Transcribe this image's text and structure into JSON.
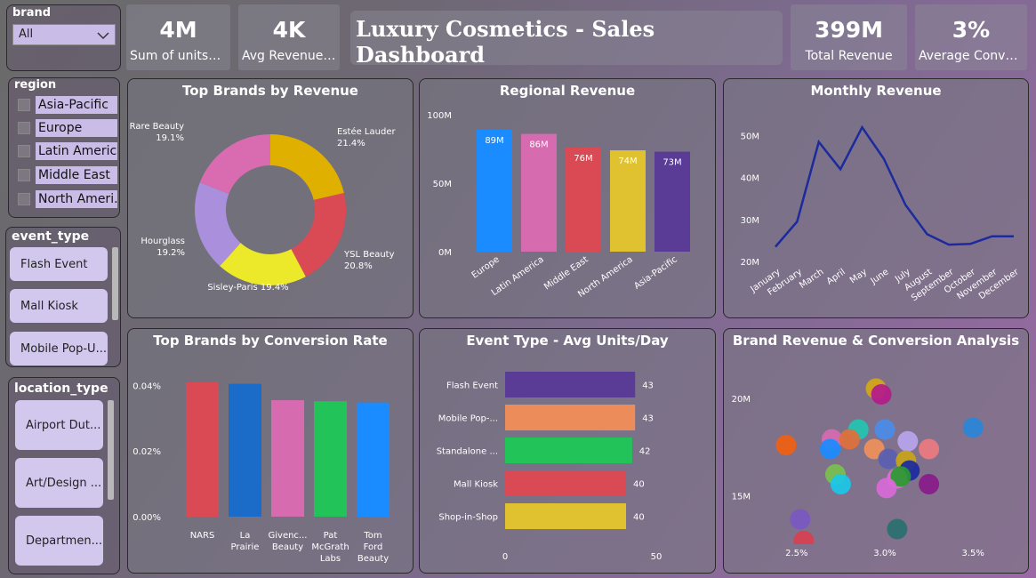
{
  "title": "Luxury Cosmetics - Sales Dashboard",
  "kpis": [
    {
      "value": "4M",
      "label": "Sum of units_sold"
    },
    {
      "value": "4K",
      "label": "Avg Revenue ..."
    },
    {
      "value": "399M",
      "label": "Total Revenue"
    },
    {
      "value": "3%",
      "label": "Average Conver..."
    }
  ],
  "brand_slicer": {
    "title": "brand",
    "selected": "All"
  },
  "region_slicer": {
    "title": "region",
    "items": [
      "Asia-Pacific",
      "Europe",
      "Latin America",
      "Middle East",
      "North Ameri..."
    ]
  },
  "event_slicer": {
    "title": "event_type",
    "items": [
      "Flash Event",
      "Mall Kiosk",
      "Mobile Pop-U..."
    ]
  },
  "location_slicer": {
    "title": "location_type",
    "items": [
      "Airport Dut...",
      "Art/Design ...",
      "Departmen..."
    ]
  },
  "chart_data": [
    {
      "id": "donut",
      "type": "pie",
      "title": "Top Brands by Revenue",
      "labels": [
        "Estée Lauder",
        "YSL Beauty",
        "Sisley-Paris",
        "Hourglass",
        "Rare Beauty"
      ],
      "values": [
        21.4,
        20.8,
        19.4,
        19.2,
        19.1
      ],
      "pct_labels": [
        "21.4%",
        "20.8%",
        "19.4%",
        "19.2%",
        "19.1%"
      ],
      "colors": [
        "#e0b000",
        "#d94a54",
        "#ece82a",
        "#a98fdc",
        "#d96cb0"
      ]
    },
    {
      "id": "regional",
      "type": "bar",
      "title": "Regional Revenue",
      "categories": [
        "Europe",
        "Latin America",
        "Middle East",
        "North America",
        "Asia-Pacific"
      ],
      "values": [
        89,
        86,
        76,
        74,
        73
      ],
      "data_labels": [
        "89M",
        "86M",
        "76M",
        "74M",
        "73M"
      ],
      "colors": [
        "#1a8cff",
        "#d76bb0",
        "#d94a54",
        "#e0c230",
        "#5a3b96"
      ],
      "ylim": [
        0,
        100
      ],
      "yticks": [
        0,
        50,
        100
      ],
      "ytick_labels": [
        "0M",
        "50M",
        "100M"
      ]
    },
    {
      "id": "monthly",
      "type": "line",
      "title": "Monthly Revenue",
      "categories": [
        "January",
        "February",
        "March",
        "April",
        "May",
        "June",
        "July",
        "August",
        "September",
        "October",
        "November",
        "December"
      ],
      "values": [
        23.5,
        29.5,
        48.5,
        42,
        52,
        44.5,
        33.5,
        26.5,
        24,
        24.2,
        26,
        26
      ],
      "ylim": [
        20,
        55
      ],
      "yticks": [
        20,
        30,
        40,
        50
      ],
      "ytick_labels": [
        "20M",
        "30M",
        "40M",
        "50M"
      ],
      "color": "#1c2a9e"
    },
    {
      "id": "conversion",
      "type": "bar",
      "title": "Top Brands by Conversion Rate",
      "categories": [
        "NARS",
        "La Prairie",
        "Givench... Beauty",
        "Pat McGrath Labs",
        "Tom Ford Beauty"
      ],
      "category_lines": [
        [
          "NARS"
        ],
        [
          "La",
          "Prairie"
        ],
        [
          "Givenc...",
          "Beauty"
        ],
        [
          "Pat",
          "McGrath",
          "Labs"
        ],
        [
          "Tom",
          "Ford",
          "Beauty"
        ]
      ],
      "values": [
        0.041,
        0.0405,
        0.0355,
        0.0352,
        0.0348
      ],
      "colors": [
        "#d94a54",
        "#1a6cc8",
        "#d76bb0",
        "#22c45a",
        "#1a8cff"
      ],
      "ylim": [
        0,
        0.045
      ],
      "yticks": [
        0,
        0.02,
        0.04
      ],
      "ytick_labels": [
        "0.00%",
        "0.02%",
        "0.04%"
      ]
    },
    {
      "id": "event",
      "type": "bar",
      "orientation": "horizontal",
      "title": "Event Type - Avg Units/Day",
      "categories": [
        "Flash Event",
        "Mobile Pop-...",
        "Standalone ...",
        "Mall Kiosk",
        "Shop-in-Shop"
      ],
      "values": [
        43,
        43,
        42,
        40,
        40
      ],
      "data_labels": [
        "43",
        "43",
        "42",
        "40",
        "40"
      ],
      "colors": [
        "#5a3b96",
        "#ec8c5a",
        "#22c45a",
        "#d94a54",
        "#e0c230"
      ],
      "xlim": [
        0,
        50
      ],
      "xticks": [
        0,
        50
      ],
      "xtick_labels": [
        "0",
        "50"
      ]
    },
    {
      "id": "scatter",
      "type": "scatter",
      "title": "Brand Revenue & Conversion Analysis",
      "xlim": [
        2.4,
        3.6
      ],
      "ylim": [
        12.8,
        21.5
      ],
      "xticks": [
        2.5,
        3.0,
        3.5
      ],
      "xtick_labels": [
        "2.5%",
        "3.0%",
        "3.5%"
      ],
      "yticks": [
        15,
        20
      ],
      "ytick_labels": [
        "15M",
        "20M"
      ],
      "points": [
        {
          "x": 2.95,
          "y": 20.5,
          "c": "#d4a816"
        },
        {
          "x": 2.98,
          "y": 20.2,
          "c": "#b41a8a"
        },
        {
          "x": 3.5,
          "y": 18.5,
          "c": "#2a86d8"
        },
        {
          "x": 2.85,
          "y": 18.4,
          "c": "#22c4b0"
        },
        {
          "x": 3.0,
          "y": 18.4,
          "c": "#4a8ce8"
        },
        {
          "x": 2.7,
          "y": 17.9,
          "c": "#d76bb0"
        },
        {
          "x": 2.8,
          "y": 17.9,
          "c": "#e0703a"
        },
        {
          "x": 3.13,
          "y": 17.8,
          "c": "#b8a4ec"
        },
        {
          "x": 2.44,
          "y": 17.6,
          "c": "#f06010"
        },
        {
          "x": 2.69,
          "y": 17.4,
          "c": "#1a8cff"
        },
        {
          "x": 2.94,
          "y": 17.4,
          "c": "#f0905a"
        },
        {
          "x": 3.25,
          "y": 17.4,
          "c": "#ee7a80"
        },
        {
          "x": 3.02,
          "y": 16.9,
          "c": "#5a60b0"
        },
        {
          "x": 3.12,
          "y": 16.8,
          "c": "#c8a418"
        },
        {
          "x": 3.14,
          "y": 16.3,
          "c": "#1a2a9e"
        },
        {
          "x": 2.72,
          "y": 16.1,
          "c": "#7ac050"
        },
        {
          "x": 3.07,
          "y": 15.9,
          "c": "#e070d0"
        },
        {
          "x": 3.09,
          "y": 16.0,
          "c": "#2a9a30"
        },
        {
          "x": 3.25,
          "y": 15.6,
          "c": "#8a1a8a"
        },
        {
          "x": 2.75,
          "y": 15.6,
          "c": "#1ac8e8"
        },
        {
          "x": 3.01,
          "y": 15.4,
          "c": "#d86ad8"
        },
        {
          "x": 2.52,
          "y": 13.8,
          "c": "#7a58c0"
        },
        {
          "x": 3.07,
          "y": 13.3,
          "c": "#2a7070"
        },
        {
          "x": 2.54,
          "y": 12.7,
          "c": "#d84050"
        }
      ]
    }
  ]
}
